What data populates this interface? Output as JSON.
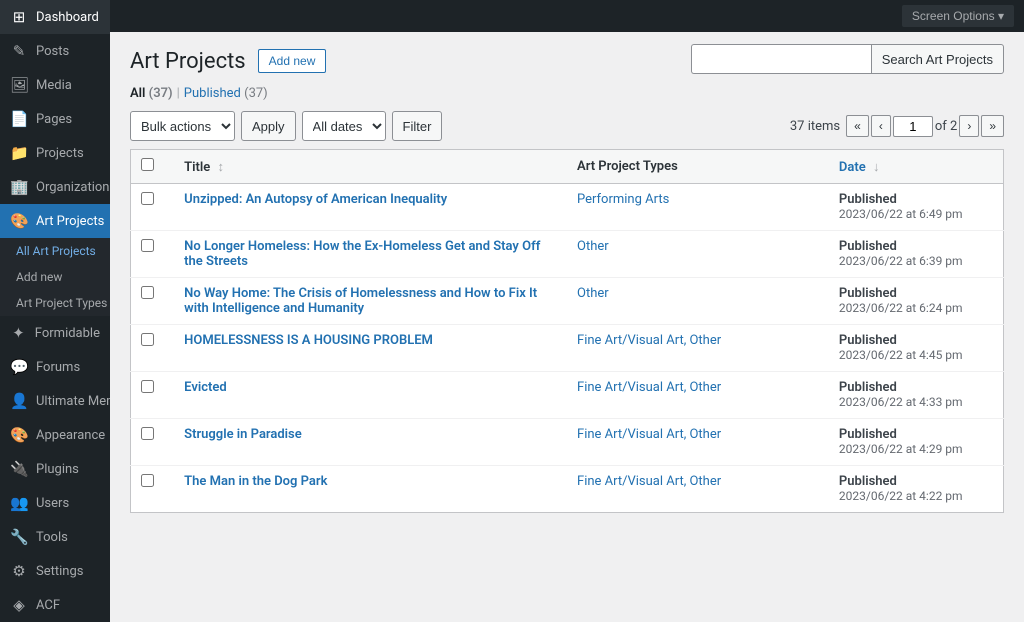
{
  "sidebar": {
    "items": [
      {
        "label": "Dashboard",
        "icon": "⊞",
        "name": "dashboard"
      },
      {
        "label": "Posts",
        "icon": "📝",
        "name": "posts"
      },
      {
        "label": "Media",
        "icon": "🖼",
        "name": "media"
      },
      {
        "label": "Pages",
        "icon": "📄",
        "name": "pages"
      },
      {
        "label": "Projects",
        "icon": "📁",
        "name": "projects"
      },
      {
        "label": "Organizations",
        "icon": "🏢",
        "name": "organizations"
      },
      {
        "label": "Art Projects",
        "icon": "🎨",
        "name": "art-projects"
      },
      {
        "label": "Formidable",
        "icon": "✦",
        "name": "formidable"
      },
      {
        "label": "Forums",
        "icon": "💬",
        "name": "forums"
      },
      {
        "label": "Ultimate Member",
        "icon": "👤",
        "name": "ultimate-member"
      },
      {
        "label": "Appearance",
        "icon": "🎨",
        "name": "appearance"
      },
      {
        "label": "Plugins",
        "icon": "🔌",
        "name": "plugins"
      },
      {
        "label": "Users",
        "icon": "👥",
        "name": "users"
      },
      {
        "label": "Tools",
        "icon": "🔧",
        "name": "tools"
      },
      {
        "label": "Settings",
        "icon": "⚙",
        "name": "settings"
      },
      {
        "label": "ACF",
        "icon": "◈",
        "name": "acf"
      }
    ],
    "sub_items": [
      {
        "label": "All Art Projects",
        "name": "all-art-projects",
        "active": true
      },
      {
        "label": "Add new",
        "name": "add-new-sub"
      },
      {
        "label": "Art Project Types",
        "name": "art-project-types"
      }
    ]
  },
  "topbar": {
    "screen_options": "Screen Options ▾"
  },
  "page": {
    "title": "Art Projects",
    "add_new_label": "Add new",
    "all_label": "All",
    "all_count": "(37)",
    "published_label": "Published",
    "published_count": "(37)",
    "separator": "|"
  },
  "toolbar": {
    "bulk_actions_label": "Bulk actions",
    "apply_label": "Apply",
    "all_dates_label": "All dates",
    "filter_label": "Filter",
    "items_count": "37 items",
    "page_current": "1",
    "page_total": "2",
    "of_label": "of"
  },
  "search": {
    "placeholder": "",
    "button_label": "Search Art Projects"
  },
  "table": {
    "headers": [
      {
        "label": "Title",
        "sort": "↕",
        "name": "title-header"
      },
      {
        "label": "Art Project Types",
        "name": "types-header"
      },
      {
        "label": "Date",
        "sort": "↓",
        "name": "date-header"
      }
    ],
    "rows": [
      {
        "title": "Unzipped: An Autopsy of American Inequality",
        "types": "Performing Arts",
        "status": "Published",
        "date": "2023/06/22 at 6:49 pm"
      },
      {
        "title": "No Longer Homeless: How the Ex-Homeless Get and Stay Off the Streets",
        "types": "Other",
        "status": "Published",
        "date": "2023/06/22 at 6:39 pm"
      },
      {
        "title": "No Way Home: The Crisis of Homelessness and How to Fix It with Intelligence and Humanity",
        "types": "Other",
        "status": "Published",
        "date": "2023/06/22 at 6:24 pm"
      },
      {
        "title": "HOMELESSNESS IS A HOUSING PROBLEM",
        "types": "Fine Art/Visual Art, Other",
        "status": "Published",
        "date": "2023/06/22 at 4:45 pm"
      },
      {
        "title": "Evicted",
        "types": "Fine Art/Visual Art, Other",
        "status": "Published",
        "date": "2023/06/22 at 4:33 pm"
      },
      {
        "title": "Struggle in Paradise",
        "types": "Fine Art/Visual Art, Other",
        "status": "Published",
        "date": "2023/06/22 at 4:29 pm"
      },
      {
        "title": "The Man in the Dog Park",
        "types": "Fine Art/Visual Art, Other",
        "status": "Published",
        "date": "2023/06/22 at 4:22 pm"
      }
    ]
  }
}
